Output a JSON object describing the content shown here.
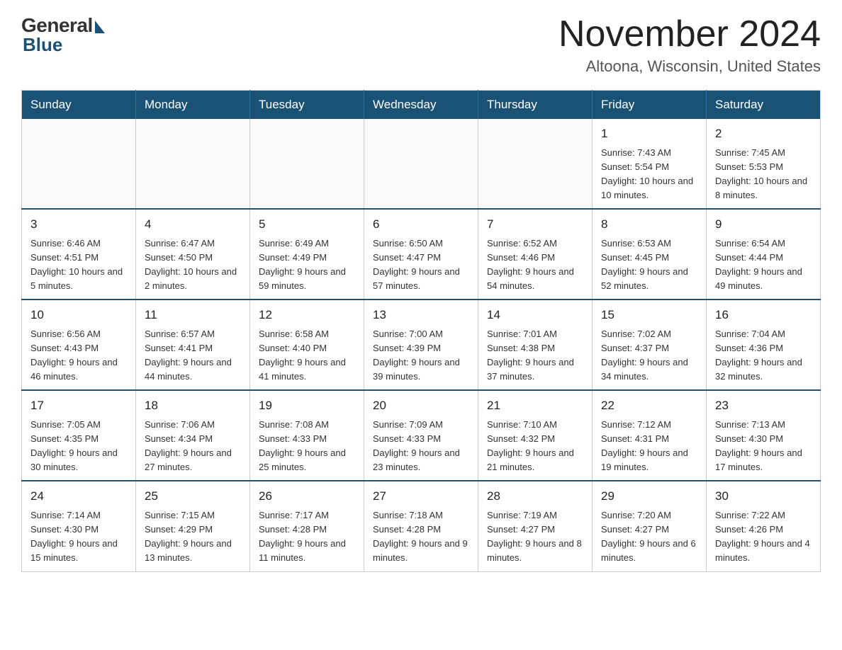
{
  "header": {
    "logo": {
      "general": "General",
      "blue": "Blue"
    },
    "title": "November 2024",
    "subtitle": "Altoona, Wisconsin, United States"
  },
  "calendar": {
    "weekdays": [
      "Sunday",
      "Monday",
      "Tuesday",
      "Wednesday",
      "Thursday",
      "Friday",
      "Saturday"
    ],
    "weeks": [
      [
        {
          "day": "",
          "info": ""
        },
        {
          "day": "",
          "info": ""
        },
        {
          "day": "",
          "info": ""
        },
        {
          "day": "",
          "info": ""
        },
        {
          "day": "",
          "info": ""
        },
        {
          "day": "1",
          "info": "Sunrise: 7:43 AM\nSunset: 5:54 PM\nDaylight: 10 hours and 10 minutes."
        },
        {
          "day": "2",
          "info": "Sunrise: 7:45 AM\nSunset: 5:53 PM\nDaylight: 10 hours and 8 minutes."
        }
      ],
      [
        {
          "day": "3",
          "info": "Sunrise: 6:46 AM\nSunset: 4:51 PM\nDaylight: 10 hours and 5 minutes."
        },
        {
          "day": "4",
          "info": "Sunrise: 6:47 AM\nSunset: 4:50 PM\nDaylight: 10 hours and 2 minutes."
        },
        {
          "day": "5",
          "info": "Sunrise: 6:49 AM\nSunset: 4:49 PM\nDaylight: 9 hours and 59 minutes."
        },
        {
          "day": "6",
          "info": "Sunrise: 6:50 AM\nSunset: 4:47 PM\nDaylight: 9 hours and 57 minutes."
        },
        {
          "day": "7",
          "info": "Sunrise: 6:52 AM\nSunset: 4:46 PM\nDaylight: 9 hours and 54 minutes."
        },
        {
          "day": "8",
          "info": "Sunrise: 6:53 AM\nSunset: 4:45 PM\nDaylight: 9 hours and 52 minutes."
        },
        {
          "day": "9",
          "info": "Sunrise: 6:54 AM\nSunset: 4:44 PM\nDaylight: 9 hours and 49 minutes."
        }
      ],
      [
        {
          "day": "10",
          "info": "Sunrise: 6:56 AM\nSunset: 4:43 PM\nDaylight: 9 hours and 46 minutes."
        },
        {
          "day": "11",
          "info": "Sunrise: 6:57 AM\nSunset: 4:41 PM\nDaylight: 9 hours and 44 minutes."
        },
        {
          "day": "12",
          "info": "Sunrise: 6:58 AM\nSunset: 4:40 PM\nDaylight: 9 hours and 41 minutes."
        },
        {
          "day": "13",
          "info": "Sunrise: 7:00 AM\nSunset: 4:39 PM\nDaylight: 9 hours and 39 minutes."
        },
        {
          "day": "14",
          "info": "Sunrise: 7:01 AM\nSunset: 4:38 PM\nDaylight: 9 hours and 37 minutes."
        },
        {
          "day": "15",
          "info": "Sunrise: 7:02 AM\nSunset: 4:37 PM\nDaylight: 9 hours and 34 minutes."
        },
        {
          "day": "16",
          "info": "Sunrise: 7:04 AM\nSunset: 4:36 PM\nDaylight: 9 hours and 32 minutes."
        }
      ],
      [
        {
          "day": "17",
          "info": "Sunrise: 7:05 AM\nSunset: 4:35 PM\nDaylight: 9 hours and 30 minutes."
        },
        {
          "day": "18",
          "info": "Sunrise: 7:06 AM\nSunset: 4:34 PM\nDaylight: 9 hours and 27 minutes."
        },
        {
          "day": "19",
          "info": "Sunrise: 7:08 AM\nSunset: 4:33 PM\nDaylight: 9 hours and 25 minutes."
        },
        {
          "day": "20",
          "info": "Sunrise: 7:09 AM\nSunset: 4:33 PM\nDaylight: 9 hours and 23 minutes."
        },
        {
          "day": "21",
          "info": "Sunrise: 7:10 AM\nSunset: 4:32 PM\nDaylight: 9 hours and 21 minutes."
        },
        {
          "day": "22",
          "info": "Sunrise: 7:12 AM\nSunset: 4:31 PM\nDaylight: 9 hours and 19 minutes."
        },
        {
          "day": "23",
          "info": "Sunrise: 7:13 AM\nSunset: 4:30 PM\nDaylight: 9 hours and 17 minutes."
        }
      ],
      [
        {
          "day": "24",
          "info": "Sunrise: 7:14 AM\nSunset: 4:30 PM\nDaylight: 9 hours and 15 minutes."
        },
        {
          "day": "25",
          "info": "Sunrise: 7:15 AM\nSunset: 4:29 PM\nDaylight: 9 hours and 13 minutes."
        },
        {
          "day": "26",
          "info": "Sunrise: 7:17 AM\nSunset: 4:28 PM\nDaylight: 9 hours and 11 minutes."
        },
        {
          "day": "27",
          "info": "Sunrise: 7:18 AM\nSunset: 4:28 PM\nDaylight: 9 hours and 9 minutes."
        },
        {
          "day": "28",
          "info": "Sunrise: 7:19 AM\nSunset: 4:27 PM\nDaylight: 9 hours and 8 minutes."
        },
        {
          "day": "29",
          "info": "Sunrise: 7:20 AM\nSunset: 4:27 PM\nDaylight: 9 hours and 6 minutes."
        },
        {
          "day": "30",
          "info": "Sunrise: 7:22 AM\nSunset: 4:26 PM\nDaylight: 9 hours and 4 minutes."
        }
      ]
    ]
  }
}
